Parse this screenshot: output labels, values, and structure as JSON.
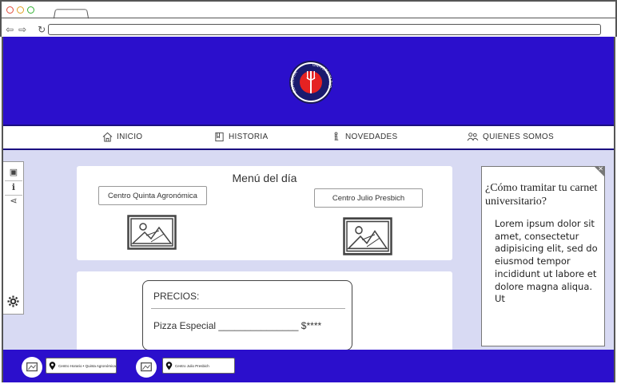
{
  "nav": {
    "inicio": "INICIO",
    "historia": "HISTORIA",
    "novedades": "NOVEDADES",
    "quienes": "QUIENES SOMOS"
  },
  "logo": {
    "text_left": "COMEDOR",
    "text_right": "UNIVERSITARIO"
  },
  "menu": {
    "title": "Menú del día",
    "location_1": "Centro Quinta Agronómica",
    "location_2": "Centro Julio Presbich"
  },
  "prices": {
    "title": "PRECIOS:",
    "row": "Pizza Especial _______________ $****"
  },
  "info": {
    "title": "¿Cómo tramitar tu carnet universitario?",
    "body": "Lorem ipsum dolor sit amet, consectetur adipisicing elit, sed do eiusmod tempor incididunt ut labore et dolore magna aliqua. Ut"
  },
  "footer": {
    "location_1": "Centro Horario • Quinta Agronómica",
    "location_2": "Centro Julio Presbich"
  },
  "colors": {
    "brand": "#2b0fcc",
    "page_bg": "#d8daf3"
  }
}
